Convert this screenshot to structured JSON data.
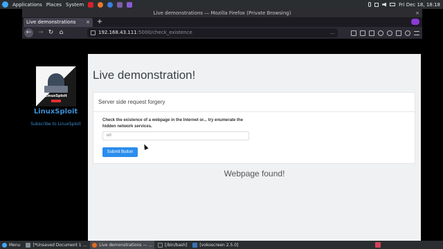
{
  "system_panel": {
    "applications": "Applications",
    "places": "Places",
    "system": "System",
    "clock": "Fri Dec 18, 18:18",
    "app_colors": [
      "#d4232b",
      "#e8772e",
      "#3b7ddd",
      "#7b5ea7",
      "#8a59d6"
    ]
  },
  "window": {
    "title": "Live demonstrations — Mozilla Firefox (Private Browsing)",
    "close_glyph": "×"
  },
  "tabs": [
    {
      "label": "Live demonstrations",
      "close_glyph": "×"
    }
  ],
  "new_tab_glyph": "+",
  "url": {
    "host": "192.168.43.111",
    "path": ":5000/check_existence",
    "extra": "…"
  },
  "sidebar": {
    "avatar_brand": "LinuxSploit",
    "name": "LinuxSploit",
    "subscribe": "Subscribe to LinuxSploit"
  },
  "main": {
    "title": "Live demonstration!",
    "card_header": "Server side request forgery",
    "card_text": "Check the existence of a webpage in the Internet or... try enumerate the hidden network services.",
    "input_placeholder": "url",
    "submit_label": "Submit Button",
    "result": "Webpage found!"
  },
  "taskbar": {
    "menu": "Menu",
    "tasks": [
      {
        "label": "[*Unsaved Document 1 ...",
        "color": "#7e8c94"
      },
      {
        "label": "Live demonstrations — ...",
        "color": "#e06b1e"
      },
      {
        "label": "[/bin/bash]",
        "color": "#333333"
      },
      {
        "label": "[vokoscreen 2.5.0]",
        "color": "#3a73b8"
      }
    ]
  },
  "colors": {
    "accent": "#2b8ded",
    "link": "#3d8fd6",
    "page_bg": "#f0f1f3"
  }
}
